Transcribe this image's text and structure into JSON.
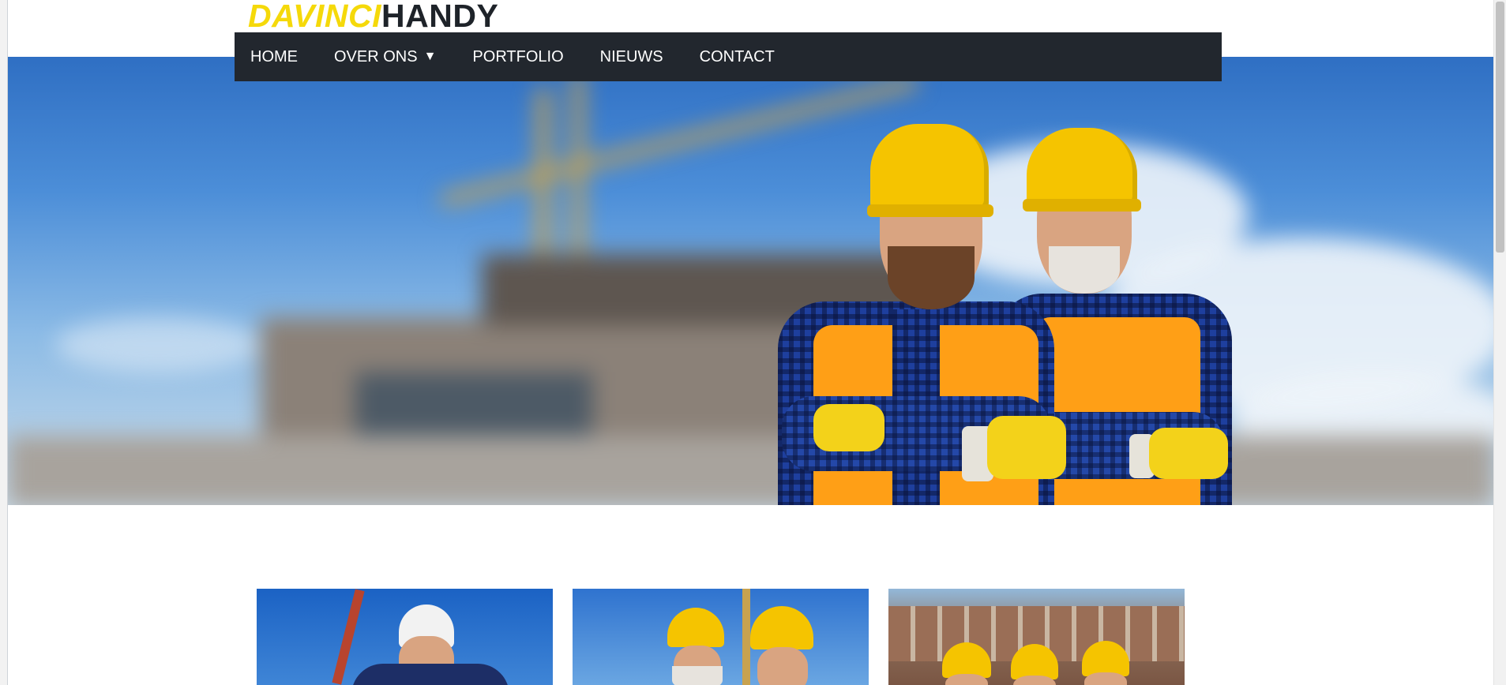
{
  "logo": {
    "part1": "DAVINCI",
    "part2": "HANDY"
  },
  "nav": {
    "items": [
      {
        "label": "HOME"
      },
      {
        "label": "OVER ONS",
        "caret": "▼"
      },
      {
        "label": "PORTFOLIO"
      },
      {
        "label": "NIEUWS"
      },
      {
        "label": "CONTACT"
      }
    ]
  },
  "colors": {
    "logo_yellow": "#f5d90a",
    "logo_dark": "#1e2329",
    "nav_background": "#22272e",
    "nav_text": "#ffffff",
    "helmet_yellow": "#f5c400",
    "vest_orange": "#ff9f16"
  },
  "hero": {
    "image": "construction-workers-hero-photo"
  },
  "cards": [
    {
      "image": "engineer-with-hard-hat-photo"
    },
    {
      "image": "workers-group-photo"
    },
    {
      "image": "workers-in-front-of-building-photo"
    }
  ]
}
